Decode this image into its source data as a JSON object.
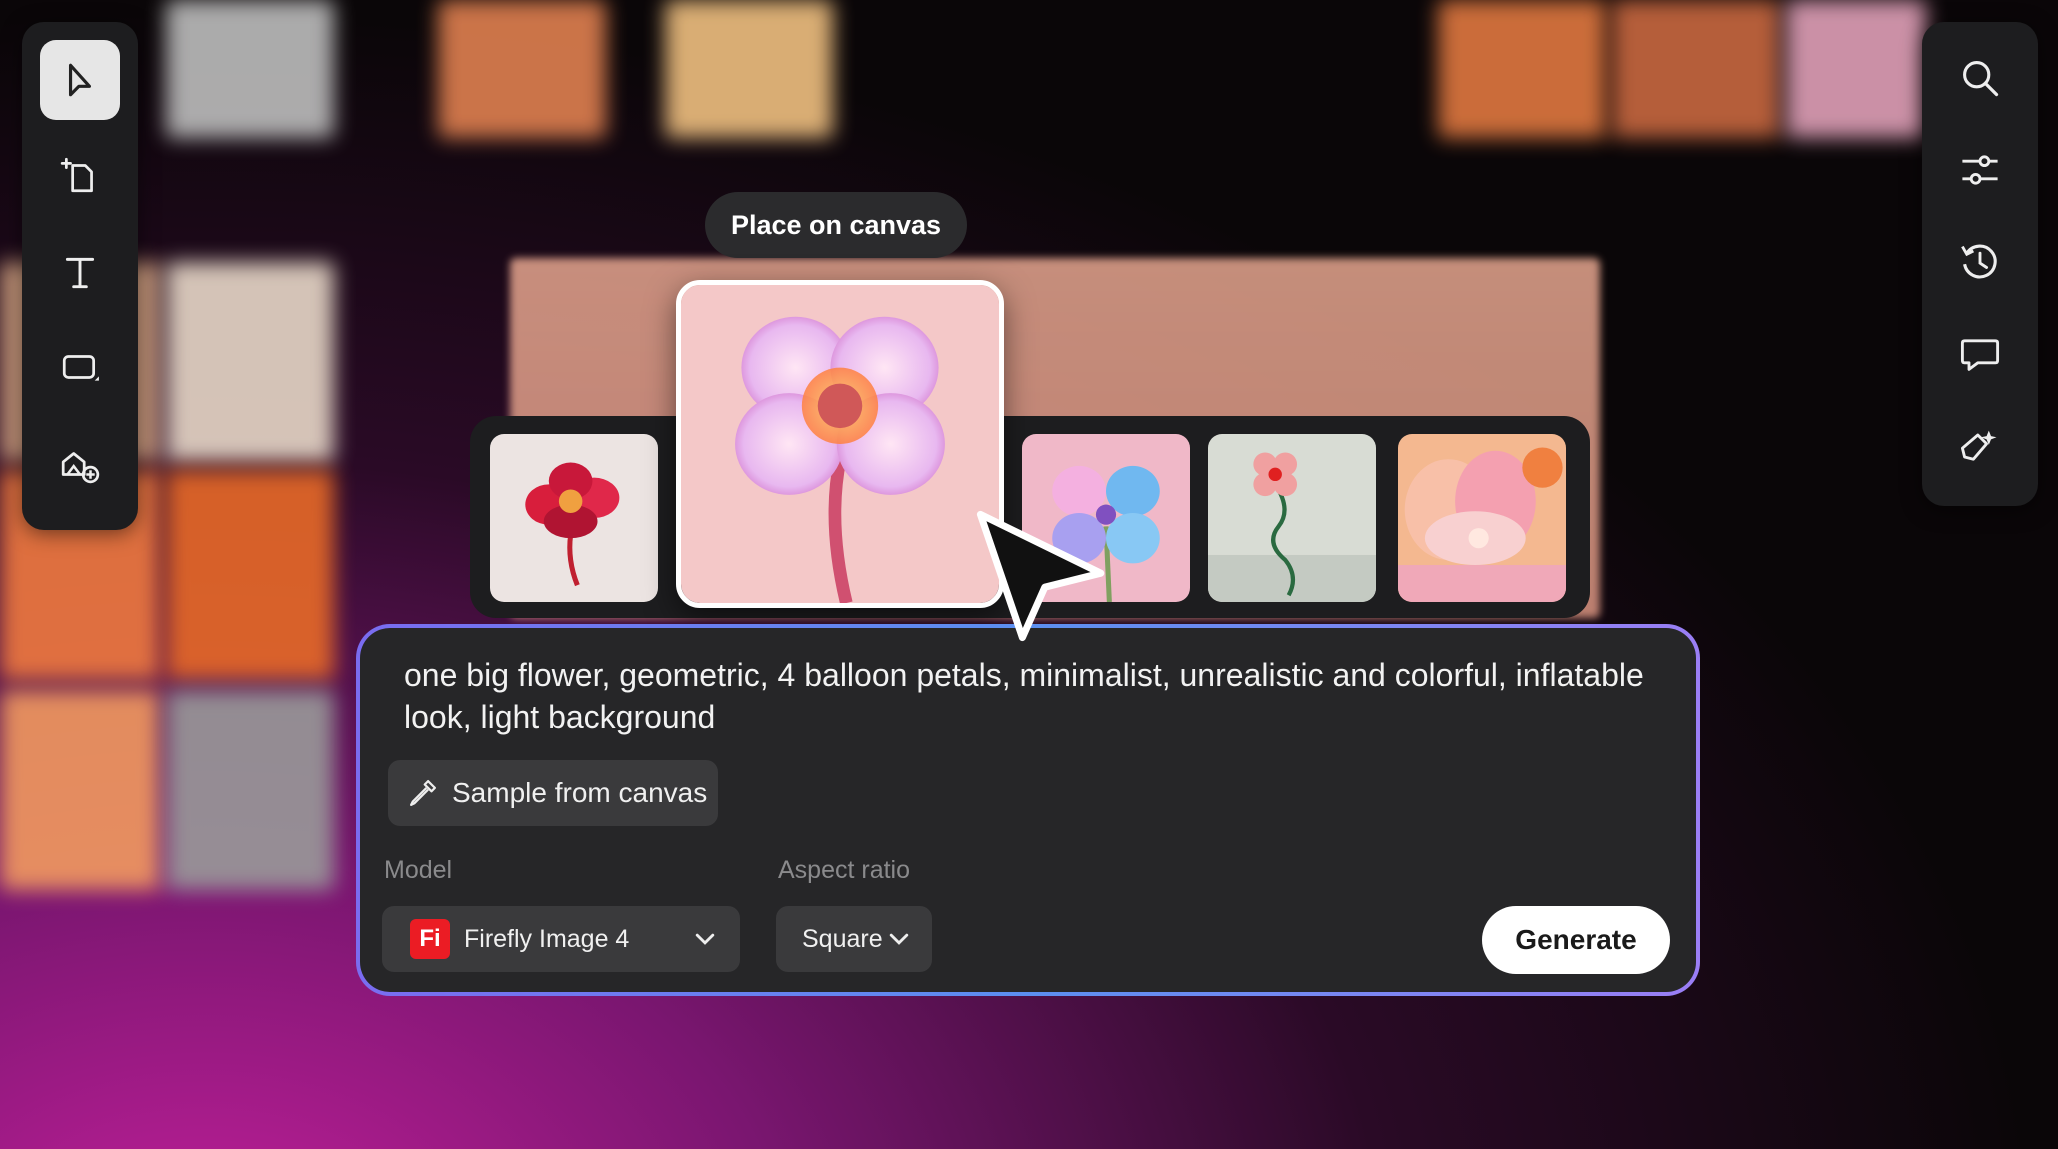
{
  "tooltip": {
    "label": "Place on canvas"
  },
  "left_toolbar": {
    "tools": [
      "select-tool",
      "pages-tool",
      "text-tool",
      "shape-tool",
      "generate-image-tool"
    ]
  },
  "right_toolbar": {
    "tools": [
      "search",
      "adjustments",
      "history",
      "comments",
      "quick-actions"
    ]
  },
  "thumbnails": {
    "selected_index": 1,
    "items": [
      "red balloon flower",
      "glowing four-petal flower",
      "blue balloon flower",
      "small flower on stem",
      "pink inflatable scene"
    ]
  },
  "prompt": {
    "text": "one big flower, geometric, 4 balloon petals, minimalist, unrealistic and colorful, inflatable look, light background",
    "sample_label": "Sample from canvas",
    "model_label": "Model",
    "model_value": "Firefly Image 4",
    "model_badge": "Fi",
    "aspect_label": "Aspect ratio",
    "aspect_value": "Square",
    "generate_label": "Generate"
  },
  "colors": {
    "accent_border": "#6f8af0",
    "firefly_red": "#eb1c24",
    "panel_bg": "#262628"
  }
}
